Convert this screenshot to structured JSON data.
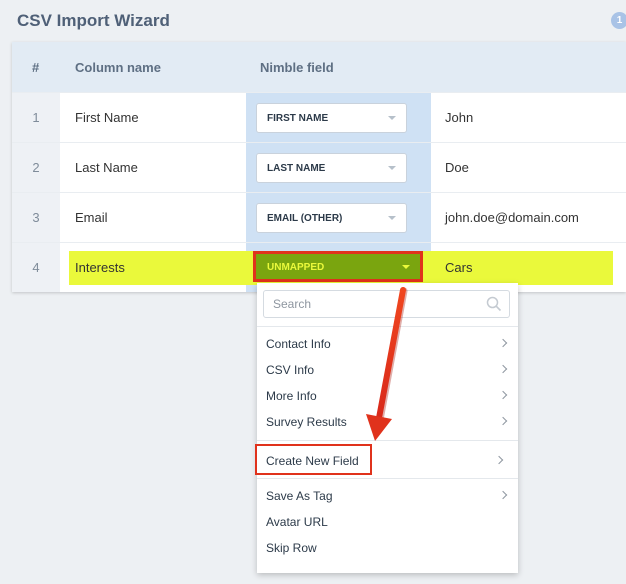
{
  "title": "CSV Import Wizard",
  "step_badge": "1",
  "table": {
    "headers": {
      "num": "#",
      "column_name": "Column name",
      "nimble_field": "Nimble field"
    },
    "rows": [
      {
        "num": "1",
        "column": "First Name",
        "field": "FIRST NAME",
        "value": "John"
      },
      {
        "num": "2",
        "column": "Last Name",
        "field": "LAST NAME",
        "value": "Doe"
      },
      {
        "num": "3",
        "column": "Email",
        "field": "EMAIL (OTHER)",
        "value": "john.doe@domain.com"
      },
      {
        "num": "4",
        "column": "Interests",
        "field": "UNMAPPED",
        "value": "Cars"
      }
    ]
  },
  "dropdown": {
    "search_placeholder": "Search",
    "groups": [
      [
        "Contact Info",
        "CSV Info",
        "More Info",
        "Survey Results"
      ],
      [
        "Create New Field"
      ],
      [
        "Save As Tag",
        "Avatar URL",
        "Skip Row"
      ]
    ]
  },
  "colors": {
    "highlight": "#eaf93b",
    "unmapped_bg": "#7aa50f",
    "annotation_red": "#e0321c",
    "field_column_bg": "#cfe1f4"
  }
}
